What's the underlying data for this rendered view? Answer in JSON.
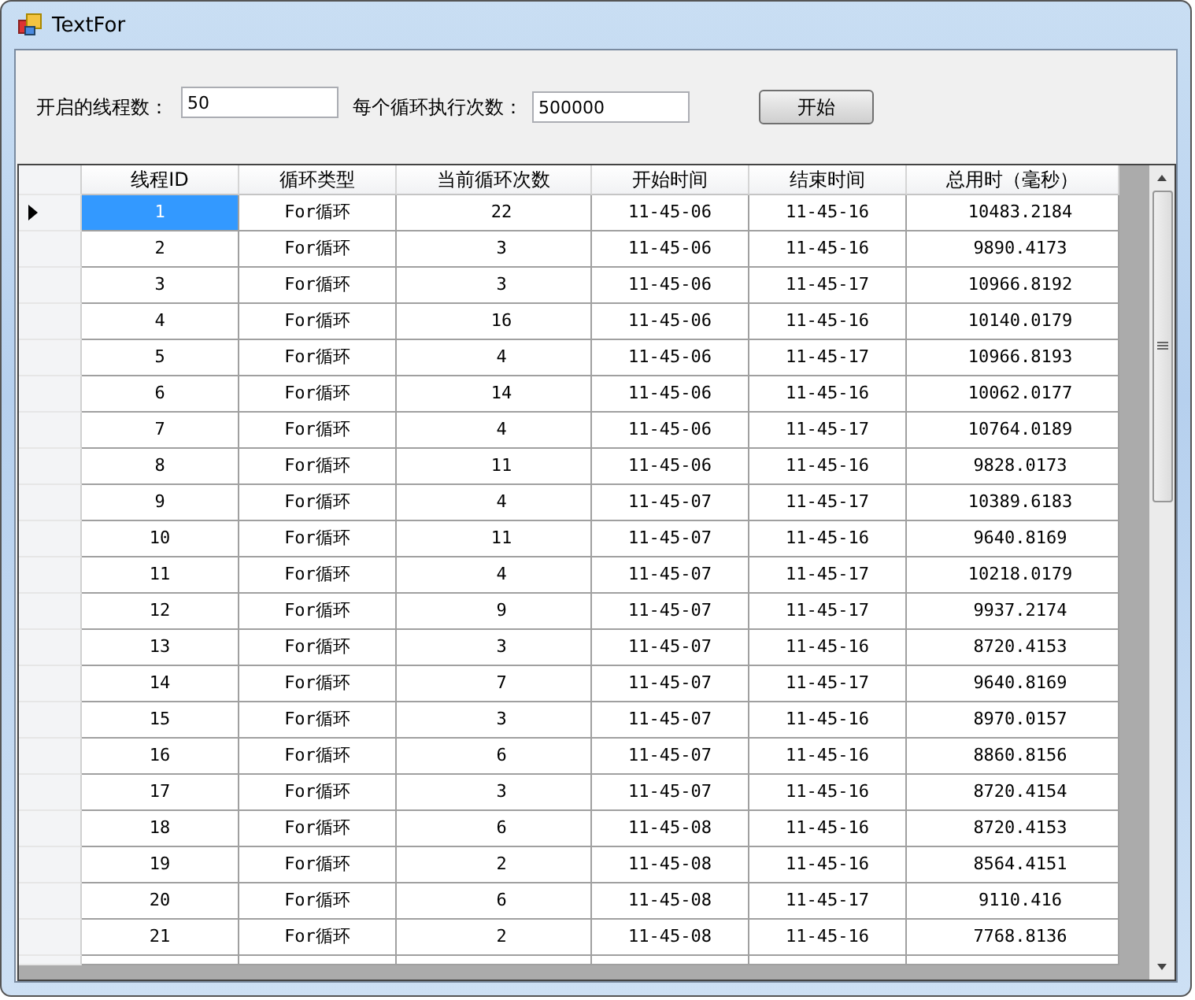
{
  "window": {
    "title": "TextFor"
  },
  "form": {
    "thread_count_label": "开启的线程数：",
    "thread_count_value": "50",
    "loop_count_label": "每个循环执行次数：",
    "loop_count_value": "500000",
    "start_button": "开始"
  },
  "table": {
    "columns": [
      "线程ID",
      "循环类型",
      "当前循环次数",
      "开始时间",
      "结束时间",
      "总用时（毫秒）"
    ],
    "rows": [
      {
        "selected": true,
        "cells": [
          "1",
          "For循环",
          "22",
          "11-45-06",
          "11-45-16",
          "10483.2184"
        ]
      },
      {
        "selected": false,
        "cells": [
          "2",
          "For循环",
          "3",
          "11-45-06",
          "11-45-16",
          "9890.4173"
        ]
      },
      {
        "selected": false,
        "cells": [
          "3",
          "For循环",
          "3",
          "11-45-06",
          "11-45-17",
          "10966.8192"
        ]
      },
      {
        "selected": false,
        "cells": [
          "4",
          "For循环",
          "16",
          "11-45-06",
          "11-45-16",
          "10140.0179"
        ]
      },
      {
        "selected": false,
        "cells": [
          "5",
          "For循环",
          "4",
          "11-45-06",
          "11-45-17",
          "10966.8193"
        ]
      },
      {
        "selected": false,
        "cells": [
          "6",
          "For循环",
          "14",
          "11-45-06",
          "11-45-16",
          "10062.0177"
        ]
      },
      {
        "selected": false,
        "cells": [
          "7",
          "For循环",
          "4",
          "11-45-06",
          "11-45-17",
          "10764.0189"
        ]
      },
      {
        "selected": false,
        "cells": [
          "8",
          "For循环",
          "11",
          "11-45-06",
          "11-45-16",
          "9828.0173"
        ]
      },
      {
        "selected": false,
        "cells": [
          "9",
          "For循环",
          "4",
          "11-45-07",
          "11-45-17",
          "10389.6183"
        ]
      },
      {
        "selected": false,
        "cells": [
          "10",
          "For循环",
          "11",
          "11-45-07",
          "11-45-16",
          "9640.8169"
        ]
      },
      {
        "selected": false,
        "cells": [
          "11",
          "For循环",
          "4",
          "11-45-07",
          "11-45-17",
          "10218.0179"
        ]
      },
      {
        "selected": false,
        "cells": [
          "12",
          "For循环",
          "9",
          "11-45-07",
          "11-45-17",
          "9937.2174"
        ]
      },
      {
        "selected": false,
        "cells": [
          "13",
          "For循环",
          "3",
          "11-45-07",
          "11-45-16",
          "8720.4153"
        ]
      },
      {
        "selected": false,
        "cells": [
          "14",
          "For循环",
          "7",
          "11-45-07",
          "11-45-17",
          "9640.8169"
        ]
      },
      {
        "selected": false,
        "cells": [
          "15",
          "For循环",
          "3",
          "11-45-07",
          "11-45-16",
          "8970.0157"
        ]
      },
      {
        "selected": false,
        "cells": [
          "16",
          "For循环",
          "6",
          "11-45-07",
          "11-45-16",
          "8860.8156"
        ]
      },
      {
        "selected": false,
        "cells": [
          "17",
          "For循环",
          "3",
          "11-45-07",
          "11-45-16",
          "8720.4154"
        ]
      },
      {
        "selected": false,
        "cells": [
          "18",
          "For循环",
          "6",
          "11-45-08",
          "11-45-16",
          "8720.4153"
        ]
      },
      {
        "selected": false,
        "cells": [
          "19",
          "For循环",
          "2",
          "11-45-08",
          "11-45-16",
          "8564.4151"
        ]
      },
      {
        "selected": false,
        "cells": [
          "20",
          "For循环",
          "6",
          "11-45-08",
          "11-45-17",
          "9110.416"
        ]
      },
      {
        "selected": false,
        "cells": [
          "21",
          "For循环",
          "2",
          "11-45-08",
          "11-45-16",
          "7768.8136"
        ]
      }
    ]
  }
}
